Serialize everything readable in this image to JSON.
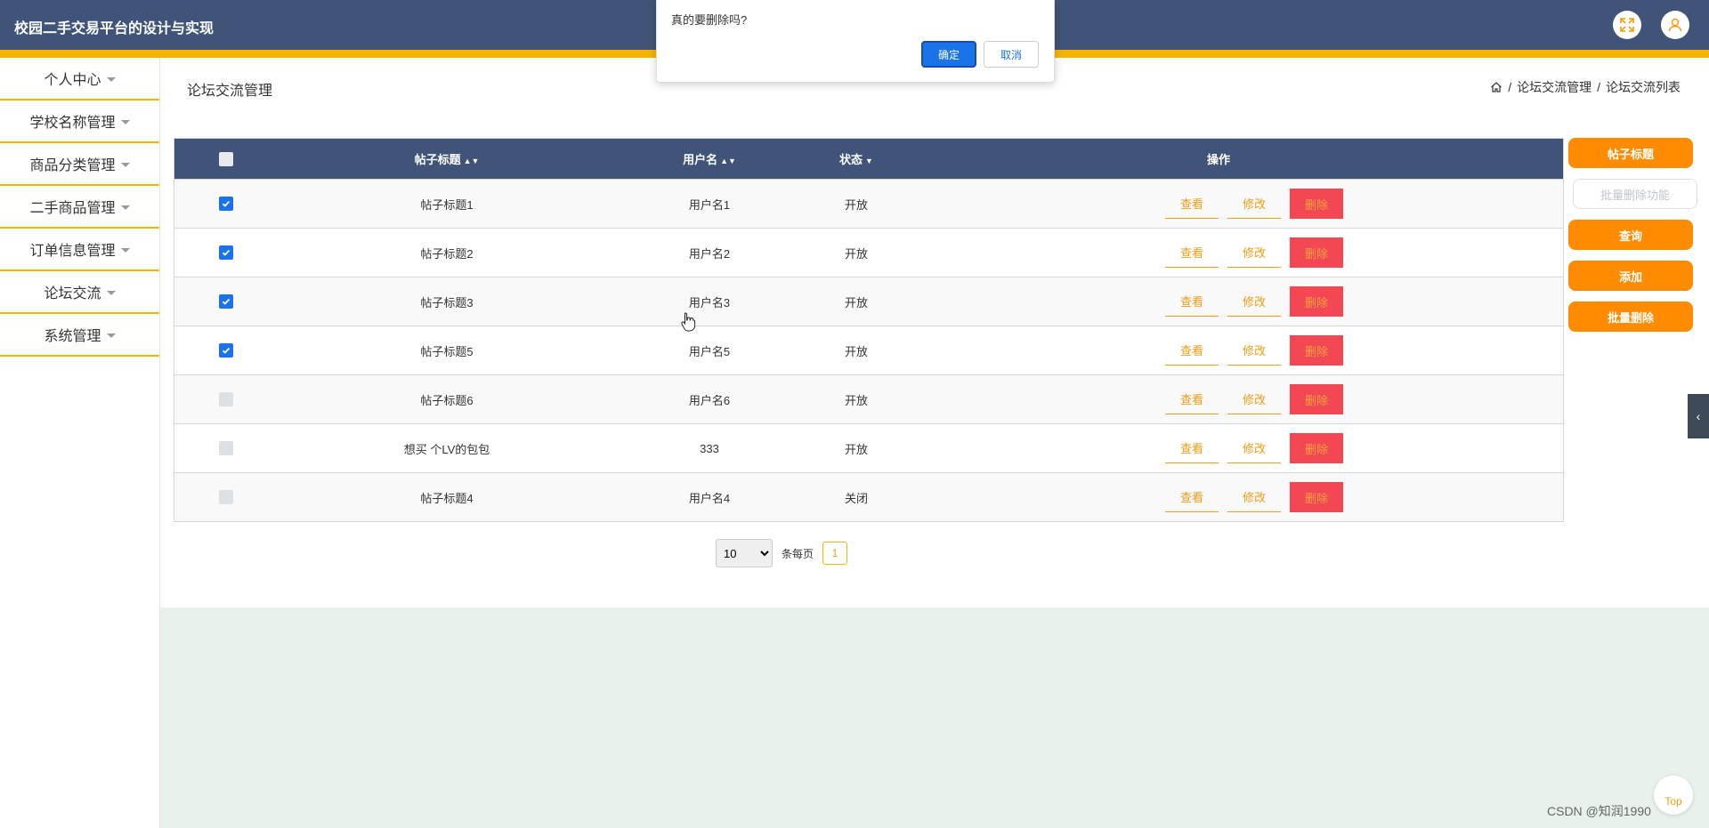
{
  "header": {
    "title": "校园二手交易平台的设计与实现",
    "fullscreen_icon": "expand-icon",
    "user_icon": "user-icon"
  },
  "sidebar": {
    "items": [
      {
        "label": "个人中心"
      },
      {
        "label": "学校名称管理"
      },
      {
        "label": "商品分类管理"
      },
      {
        "label": "二手商品管理"
      },
      {
        "label": "订单信息管理"
      },
      {
        "label": "论坛交流"
      },
      {
        "label": "系统管理"
      }
    ]
  },
  "page": {
    "title": "论坛交流管理",
    "breadcrumb": [
      "论坛交流管理",
      "论坛交流列表"
    ],
    "separator": "/"
  },
  "table": {
    "headers": {
      "title": "帖子标题",
      "user": "用户名",
      "status": "状态",
      "ops": "操作"
    },
    "rows": [
      {
        "title": "帖子标题1",
        "user": "用户名1",
        "status": "开放",
        "checked": true
      },
      {
        "title": "帖子标题2",
        "user": "用户名2",
        "status": "开放",
        "checked": true
      },
      {
        "title": "帖子标题3",
        "user": "用户名3",
        "status": "开放",
        "checked": true
      },
      {
        "title": "帖子标题5",
        "user": "用户名5",
        "status": "开放",
        "checked": true
      },
      {
        "title": "帖子标题6",
        "user": "用户名6",
        "status": "开放",
        "checked": false
      },
      {
        "title": "想买 个LV的包包",
        "user": "333",
        "status": "开放",
        "checked": false
      },
      {
        "title": "帖子标题4",
        "user": "用户名4",
        "status": "关闭",
        "checked": false
      }
    ],
    "ops": {
      "view": "查看",
      "edit": "修改",
      "delete": "删除"
    }
  },
  "right_buttons": {
    "post_title": "帖子标题",
    "batch_delete_func": "批量删除功能",
    "query": "查询",
    "add": "添加",
    "batch_delete": "批量删除"
  },
  "pagination": {
    "page_size": "10",
    "per_page_label": "条每页",
    "current_page": "1"
  },
  "dialog": {
    "message": "真的要删除吗?",
    "confirm": "确定",
    "cancel": "取消"
  },
  "misc": {
    "top_label": "Top",
    "watermark": "CSDN @知润1990"
  },
  "colors": {
    "header": "#3f5478",
    "accent": "#f5b400",
    "button": "#ff8c00",
    "delete": "#f34854",
    "checkbox": "#1a73e8"
  }
}
